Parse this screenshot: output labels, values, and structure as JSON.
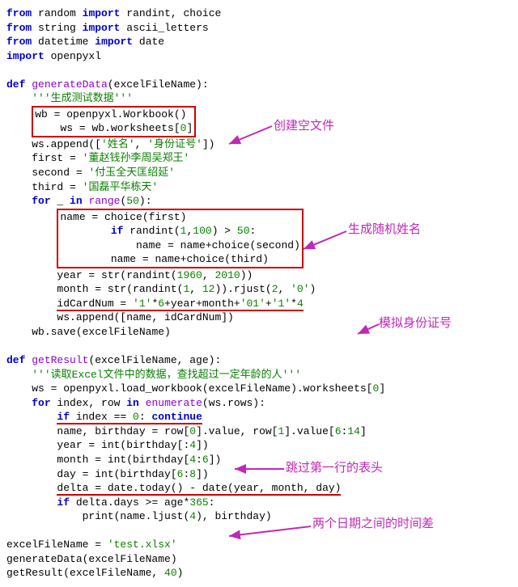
{
  "code": {
    "l1": {
      "a": "from",
      "b": "random",
      "c": "import",
      "d": "randint, choice"
    },
    "l2": {
      "a": "from",
      "b": "string",
      "c": "import",
      "d": "ascii_letters"
    },
    "l3": {
      "a": "from",
      "b": "datetime",
      "c": "import",
      "d": "date"
    },
    "l4": {
      "a": "import",
      "b": "openpyxl"
    },
    "l6": {
      "a": "def",
      "b": "generateData",
      "c": "(excelFileName):"
    },
    "l7": "'''生成测试数据'''",
    "l8a": "wb = openpyxl.Workbook()",
    "l8b": "ws = wb.worksheets[",
    "l8c": "0",
    "l8d": "]",
    "l9a": "ws.append([",
    "l9b": "'姓名'",
    "l9c": ", ",
    "l9d": "'身份证号'",
    "l9e": "])",
    "l10a": "first = ",
    "l10b": "'董赵钱孙李周吴郑王'",
    "l11a": "second = ",
    "l11b": "'付玉全天匡绍延'",
    "l12a": "third = ",
    "l12b": "'国磊平华栋天'",
    "l13a": "for",
    "l13b": " _ ",
    "l13c": "in",
    "l13d": "range",
    "l13e": "(",
    "l13f": "50",
    "l13g": "):",
    "l14": "name = choice(first)",
    "l15a": "if",
    "l15b": " randint(",
    "l15c": "1",
    "l15d": ",",
    "l15e": "100",
    "l15f": ") > ",
    "l15g": "50",
    "l15h": ":",
    "l16": "name = name+choice(second)",
    "l17": "name = name+choice(third)",
    "l18a": "year = str(randint(",
    "l18b": "1960",
    "l18c": ", ",
    "l18d": "2010",
    "l18e": "))",
    "l19a": "month = str(randint(",
    "l19b": "1",
    "l19c": ", ",
    "l19d": "12",
    "l19e": ")).rjust(",
    "l19f": "2",
    "l19g": ", ",
    "l19h": "'0'",
    "l19i": ")",
    "l20a": "idCardNum = ",
    "l20b": "'1'",
    "l20c": "*",
    "l20d": "6",
    "l20e": "+year+month+",
    "l20f": "'01'",
    "l20g": "+",
    "l20h": "'1'",
    "l20i": "*",
    "l20j": "4",
    "l21": "ws.append([name, idCardNum])",
    "l22": "wb.save(excelFileName)",
    "l24a": "def",
    "l24b": "getResult",
    "l24c": "(excelFileName, age):",
    "l25": "'''读取Excel文件中的数据，查找超过一定年龄的人'''",
    "l26a": "ws = openpyxl.load_workbook(excelFileName).worksheets[",
    "l26b": "0",
    "l26c": "]",
    "l27a": "for",
    "l27b": " index, row ",
    "l27c": "in",
    "l27d": "enumerate",
    "l27e": "(ws.rows):",
    "l28a": "if",
    "l28b": " index == ",
    "l28c": "0",
    "l28d": ": ",
    "l28e": "continue",
    "l29a": "name, birthday = row[",
    "l29b": "0",
    "l29c": "].value, row[",
    "l29d": "1",
    "l29e": "].value[",
    "l29f": "6",
    "l29g": ":",
    "l29h": "14",
    "l29i": "]",
    "l30a": "year = int(birthday[:",
    "l30b": "4",
    "l30c": "])",
    "l31a": "month = int(birthday[",
    "l31b": "4",
    "l31c": ":",
    "l31d": "6",
    "l31e": "])",
    "l32a": "day = int(birthday[",
    "l32b": "6",
    "l32c": ":",
    "l32d": "8",
    "l32e": "])",
    "l33": "delta = date.today() - date(year, month, day)",
    "l34a": "if",
    "l34b": " delta.days >= age*",
    "l34c": "365",
    "l34d": ":",
    "l35a": "print(name.ljust(",
    "l35b": "4",
    "l35c": "), birthday)",
    "l37a": "excelFileName = ",
    "l37b": "'test.xlsx'",
    "l38": "generateData(excelFileName)",
    "l39a": "getResult(excelFileName, ",
    "l39b": "40",
    "l39c": ")"
  },
  "annotations": {
    "a1": "创建空文件",
    "a2": "生成随机姓名",
    "a3": "模拟身份证号",
    "a4": "跳过第一行的表头",
    "a5": "两个日期之间的时间差"
  }
}
